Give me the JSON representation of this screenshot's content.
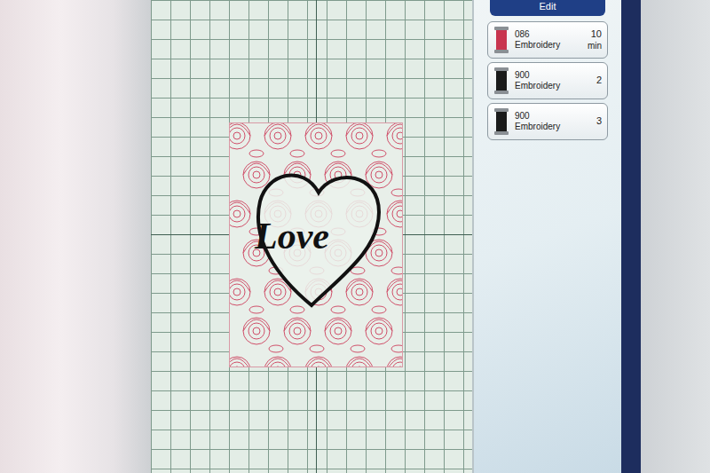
{
  "screen": {
    "edit_button": "Edit"
  },
  "design": {
    "text": "Love"
  },
  "threads": [
    {
      "code": "086",
      "name": "Embroidery",
      "value": "10",
      "unit": "min",
      "color": "#c8354f"
    },
    {
      "code": "900",
      "name": "Embroidery",
      "value": "2",
      "color": "#1b1b1b"
    },
    {
      "code": "900",
      "name": "Embroidery",
      "value": "3",
      "color": "#1b1b1b"
    }
  ]
}
